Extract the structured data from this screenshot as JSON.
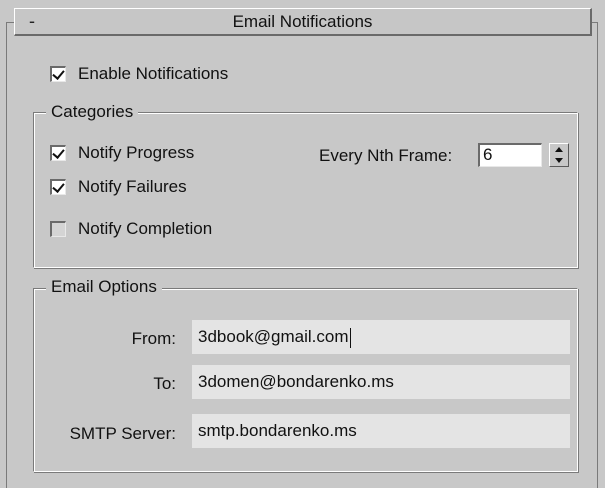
{
  "rollout": {
    "toggle": "-",
    "title": "Email Notifications"
  },
  "enable_notifications": {
    "label": "Enable Notifications",
    "checked": true
  },
  "categories": {
    "legend": "Categories",
    "notify_progress": {
      "label": "Notify Progress",
      "checked": true
    },
    "notify_failures": {
      "label": "Notify Failures",
      "checked": true
    },
    "notify_completion": {
      "label": "Notify Completion",
      "checked": false
    },
    "every_nth_frame": {
      "label": "Every Nth Frame:",
      "value": "6"
    }
  },
  "email_options": {
    "legend": "Email Options",
    "from": {
      "label": "From:",
      "value": "3dbook@gmail.com"
    },
    "to": {
      "label": "To:",
      "value": "3domen@bondarenko.ms"
    },
    "smtp": {
      "label": "SMTP Server:",
      "value": "smtp.bondarenko.ms"
    }
  }
}
